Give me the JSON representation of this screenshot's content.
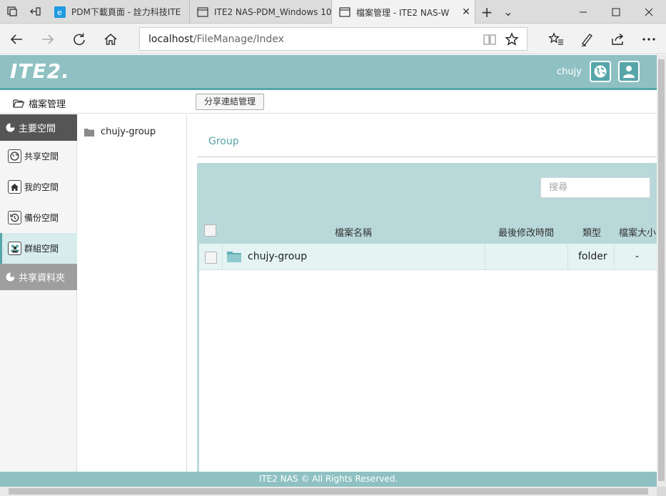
{
  "browser": {
    "tabs": [
      {
        "title": "PDM下載頁面 - 詮力科技ITE",
        "favicon": "edge-e-icon"
      },
      {
        "title": "ITE2 NAS-PDM_Windows 10",
        "favicon": "page-icon"
      },
      {
        "title": "檔案管理 - ITE2 NAS-W",
        "favicon": "page-icon",
        "active": true
      }
    ],
    "close_glyph": "✕",
    "new_tab_glyph": "+",
    "tab_list_glyph": "⌄",
    "url_host": "localhost",
    "url_path": "/FileManage/Index"
  },
  "app": {
    "logo_text": "ITE2.",
    "user_name": "chujy",
    "page_title": "檔案管理",
    "share_button_label": "分享連結管理",
    "footer_text": "ITE2 NAS © All Rights Reserved."
  },
  "sidebar": {
    "main_header": "主要空間",
    "items": [
      {
        "label": "共享空間",
        "icon": "globe-icon"
      },
      {
        "label": "我的空間",
        "icon": "home-icon"
      },
      {
        "label": "備份空間",
        "icon": "backup-icon"
      },
      {
        "label": "群組空間",
        "icon": "group-icon",
        "active": true
      }
    ],
    "shared_header": "共享資料夾"
  },
  "tree": {
    "items": [
      {
        "label": "chujy-group",
        "icon": "folder-icon"
      }
    ]
  },
  "main": {
    "breadcrumb": "Group",
    "search_placeholder": "搜尋",
    "columns": {
      "name": "檔案名稱",
      "modified": "最後修改時間",
      "type": "類型",
      "size": "檔案大小"
    },
    "rows": [
      {
        "name": "chujy-group",
        "modified": "",
        "type": "folder",
        "size": "-"
      }
    ]
  },
  "colors": {
    "header_bg": "#8fc1c3",
    "accent": "#56a5a9",
    "panel_bg": "#b8d8da",
    "row_bg": "#e5f3f3"
  }
}
